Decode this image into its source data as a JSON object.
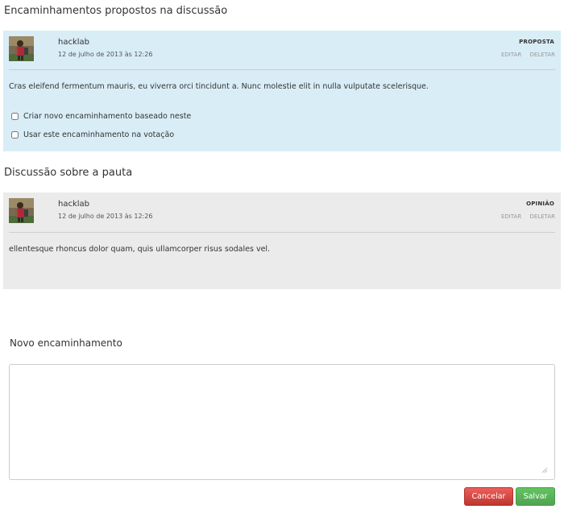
{
  "proposals_section": {
    "title": "Encaminhamentos propostos na discussão"
  },
  "proposal_card": {
    "author": "hacklab",
    "date": "12 de julho de 2013 às 12:26",
    "type": "PROPOSTA",
    "edit_label": "EDITAR",
    "delete_label": "DELETAR",
    "text": "Cras eleifend fermentum mauris, eu viverra orci tincidunt a. Nunc molestie elit in nulla vulputate scelerisque.",
    "checkbox_create": "Criar novo encaminhamento baseado neste",
    "checkbox_vote": "Usar este encaminhamento na votação",
    "bg_color": "#d9edf7"
  },
  "discussion_section": {
    "title": "Discussão sobre a pauta"
  },
  "opinion_card": {
    "author": "hacklab",
    "date": "12 de julho de 2013 às 12:26",
    "type": "OPINIÃO",
    "edit_label": "EDITAR",
    "delete_label": "DELETAR",
    "text": "ellentesque rhoncus dolor quam, quis ullamcorper risus sodales vel.",
    "bg_color": "#ebebeb"
  },
  "new_proposal": {
    "label": "Novo encaminhamento",
    "value": "",
    "cancel_label": "Cancelar",
    "save_label": "Salvar",
    "cancel_color": "#da4f49",
    "save_color": "#5bb75b"
  }
}
